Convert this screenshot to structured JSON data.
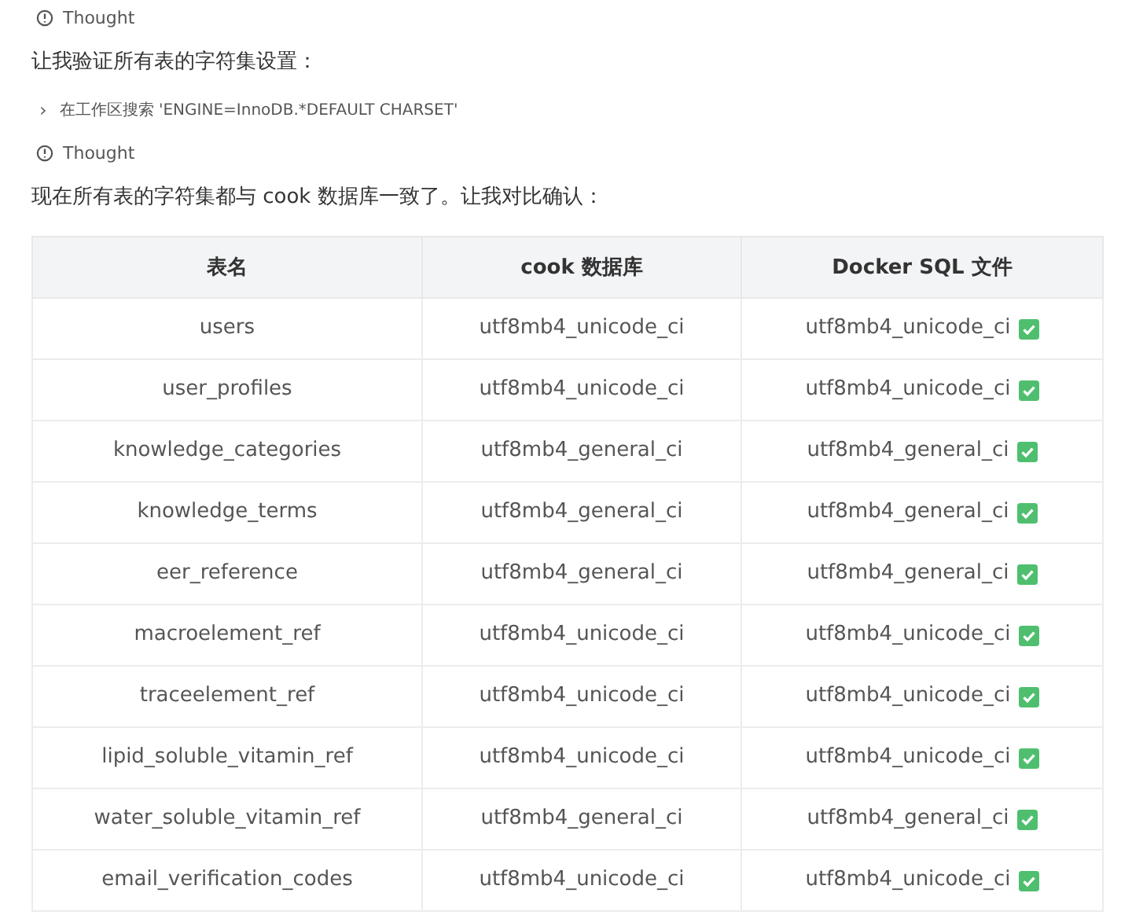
{
  "steps": [
    {
      "kind": "thought",
      "text": "Thought"
    },
    {
      "kind": "message",
      "text": "让我验证所有表的字符集设置："
    },
    {
      "kind": "search",
      "chevron": "›",
      "text": "在工作区搜索 'ENGINE=InnoDB.*DEFAULT CHARSET'"
    },
    {
      "kind": "thought",
      "text": "Thought"
    },
    {
      "kind": "message",
      "text": "现在所有表的字符集都与 cook 数据库一致了。让我对比确认："
    }
  ],
  "table": {
    "columns": [
      "表名",
      "cook 数据库",
      "Docker SQL 文件"
    ],
    "rows": [
      [
        "users",
        "utf8mb4_unicode_ci",
        "utf8mb4_unicode_ci"
      ],
      [
        "user_profiles",
        "utf8mb4_unicode_ci",
        "utf8mb4_unicode_ci"
      ],
      [
        "knowledge_categories",
        "utf8mb4_general_ci",
        "utf8mb4_general_ci"
      ],
      [
        "knowledge_terms",
        "utf8mb4_general_ci",
        "utf8mb4_general_ci"
      ],
      [
        "eer_reference",
        "utf8mb4_general_ci",
        "utf8mb4_general_ci"
      ],
      [
        "macroelement_ref",
        "utf8mb4_unicode_ci",
        "utf8mb4_unicode_ci"
      ],
      [
        "traceelement_ref",
        "utf8mb4_unicode_ci",
        "utf8mb4_unicode_ci"
      ],
      [
        "lipid_soluble_vitamin_ref",
        "utf8mb4_unicode_ci",
        "utf8mb4_unicode_ci"
      ],
      [
        "water_soluble_vitamin_ref",
        "utf8mb4_general_ci",
        "utf8mb4_general_ci"
      ],
      [
        "email_verification_codes",
        "utf8mb4_unicode_ci",
        "utf8mb4_unicode_ci"
      ]
    ]
  }
}
